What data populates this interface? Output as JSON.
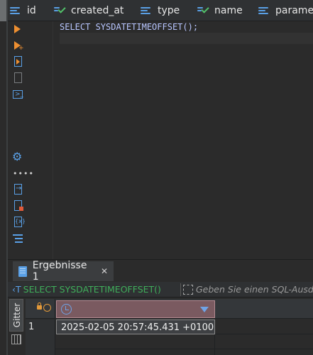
{
  "columns": [
    {
      "name": "id",
      "kind": "list"
    },
    {
      "name": "created_at",
      "kind": "check"
    },
    {
      "name": "type",
      "kind": "list"
    },
    {
      "name": "name",
      "kind": "check"
    },
    {
      "name": "paramet",
      "kind": "list"
    }
  ],
  "editor": {
    "sql": "SELECT SYSDATETIMEOFFSET();"
  },
  "toolbar_icons": [
    "execute-icon",
    "execute-new-tab-icon",
    "script-icon",
    "explain-icon",
    "console-icon",
    "settings-icon",
    "more-icon",
    "export-icon",
    "file-warning-icon",
    "variables-icon",
    "outline-icon"
  ],
  "results": {
    "tab_label": "Ergebnisse 1",
    "tab_close": "✕",
    "filter_prefix": "‹T",
    "filter_sql": "SELECT SYSDATETIMEOFFSET()",
    "filter_placeholder": "Geben Sie einen SQL-Ausd",
    "side_tab": "Gitter",
    "rows": [
      {
        "num": "1",
        "value": "2025-02-05 20:57:45.431 +0100"
      },
      {
        "num": "",
        "value": ""
      },
      {
        "num": "",
        "value": ""
      }
    ]
  },
  "colors": {
    "accent_blue": "#5aa0e6",
    "accent_green": "#52c06a",
    "run_orange": "#ee8f31",
    "filter_green": "#3fae5a",
    "header_selected": "#7a5a60"
  }
}
